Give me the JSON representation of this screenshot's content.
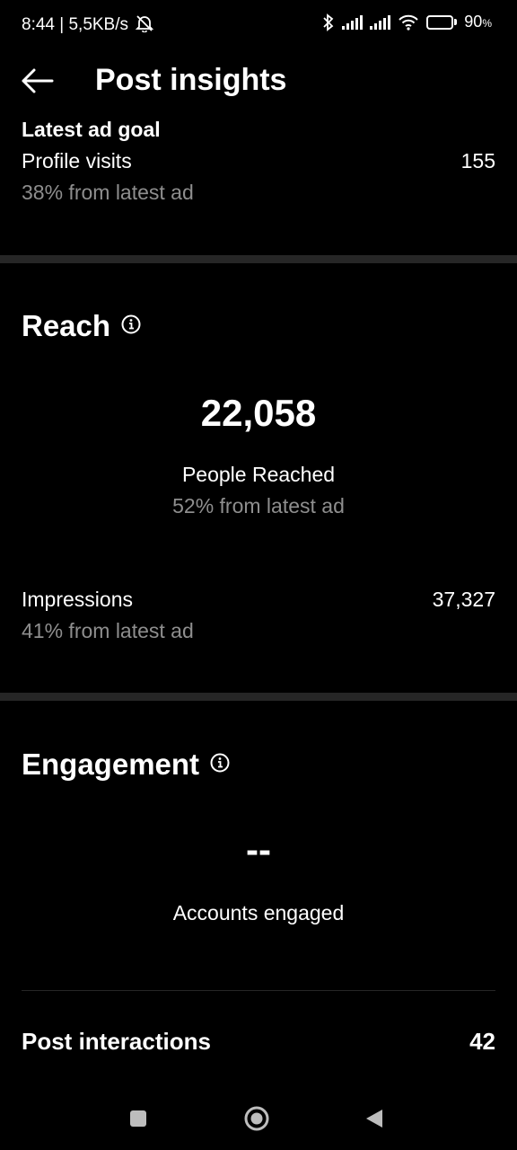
{
  "status_bar": {
    "time": "8:44 | 5,5KB/s",
    "battery": "90",
    "battery_unit": "%",
    "battery_level": 0.9,
    "icons": [
      "mute-notifications-icon",
      "bluetooth-icon",
      "signal-icon",
      "signal-icon",
      "wifi-icon",
      "battery-icon"
    ]
  },
  "header": {
    "title": "Post insights",
    "back_icon": "arrow-left-icon"
  },
  "ad_goal": {
    "heading": "Latest ad goal",
    "label": "Profile visits",
    "value": "155",
    "change": "38% from latest ad"
  },
  "reach": {
    "title": "Reach",
    "info_icon": "info-icon",
    "people_reached_value": "22,058",
    "people_reached_label": "People Reached",
    "people_reached_change": "52% from latest ad",
    "impressions_label": "Impressions",
    "impressions_value": "37,327",
    "impressions_change": "41% from latest ad"
  },
  "engagement": {
    "title": "Engagement",
    "info_icon": "info-icon",
    "accounts_engaged_value": "--",
    "accounts_engaged_label": "Accounts engaged",
    "post_interactions_label": "Post interactions",
    "post_interactions_value": "42"
  },
  "nav_bar": {
    "icons": [
      "recents-square-icon",
      "home-circle-icon",
      "back-triangle-icon"
    ]
  }
}
